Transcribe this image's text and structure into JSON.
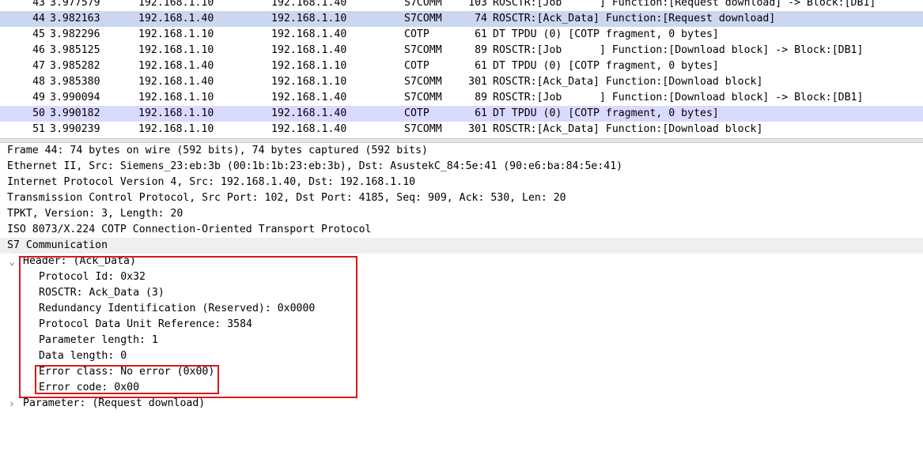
{
  "packet_list": {
    "rows": [
      {
        "no": "43",
        "time": "3.977579",
        "source": "192.168.1.10",
        "destination": "192.168.1.40",
        "protocol": "S7COMM",
        "length": "103",
        "info": "ROSCTR:[Job      ] Function:[Request download] -> Block:[DB1]",
        "style": "plain"
      },
      {
        "no": "44",
        "time": "3.982163",
        "source": "192.168.1.40",
        "destination": "192.168.1.10",
        "protocol": "S7COMM",
        "length": "74",
        "info": "ROSCTR:[Ack_Data] Function:[Request download]",
        "style": "selected"
      },
      {
        "no": "45",
        "time": "3.982296",
        "source": "192.168.1.10",
        "destination": "192.168.1.40",
        "protocol": "COTP",
        "length": "61",
        "info": "DT TPDU (0) [COTP fragment, 0 bytes]",
        "style": "plain"
      },
      {
        "no": "46",
        "time": "3.985125",
        "source": "192.168.1.10",
        "destination": "192.168.1.40",
        "protocol": "S7COMM",
        "length": "89",
        "info": "ROSCTR:[Job      ] Function:[Download block] -> Block:[DB1]",
        "style": "plain"
      },
      {
        "no": "47",
        "time": "3.985282",
        "source": "192.168.1.40",
        "destination": "192.168.1.10",
        "protocol": "COTP",
        "length": "61",
        "info": "DT TPDU (0) [COTP fragment, 0 bytes]",
        "style": "plain"
      },
      {
        "no": "48",
        "time": "3.985380",
        "source": "192.168.1.40",
        "destination": "192.168.1.10",
        "protocol": "S7COMM",
        "length": "301",
        "info": "ROSCTR:[Ack_Data] Function:[Download block]",
        "style": "plain"
      },
      {
        "no": "49",
        "time": "3.990094",
        "source": "192.168.1.10",
        "destination": "192.168.1.40",
        "protocol": "S7COMM",
        "length": "89",
        "info": "ROSCTR:[Job      ] Function:[Download block] -> Block:[DB1]",
        "style": "plain"
      },
      {
        "no": "50",
        "time": "3.990182",
        "source": "192.168.1.10",
        "destination": "192.168.1.40",
        "protocol": "COTP",
        "length": "61",
        "info": "DT TPDU (0) [COTP fragment, 0 bytes]",
        "style": "blue"
      },
      {
        "no": "51",
        "time": "3.990239",
        "source": "192.168.1.10",
        "destination": "192.168.1.40",
        "protocol": "S7COMM",
        "length": "301",
        "info": "ROSCTR:[Ack_Data] Function:[Download block]",
        "style": "plain"
      }
    ]
  },
  "details": {
    "frame": "Frame 44: 74 bytes on wire (592 bits), 74 bytes captured (592 bits)",
    "ethernet": "Ethernet II, Src: Siemens_23:eb:3b (00:1b:1b:23:eb:3b), Dst: AsustekC_84:5e:41 (90:e6:ba:84:5e:41)",
    "ip": "Internet Protocol Version 4, Src: 192.168.1.40, Dst: 192.168.1.10",
    "tcp": "Transmission Control Protocol, Src Port: 102, Dst Port: 4185, Seq: 909, Ack: 530, Len: 20",
    "tpkt": "TPKT, Version: 3, Length: 20",
    "cotp": "ISO 8073/X.224 COTP Connection-Oriented Transport Protocol",
    "s7": "S7 Communication",
    "header": {
      "label": "Header: (Ack_Data)",
      "expander": "⌄",
      "fields": {
        "protocol_id": "Protocol Id: 0x32",
        "rosctr": "ROSCTR: Ack_Data (3)",
        "redundancy": "Redundancy Identification (Reserved): 0x0000",
        "pdu_ref": "Protocol Data Unit Reference: 3584",
        "param_len": "Parameter length: 1",
        "data_len": "Data length: 0",
        "error_class": "Error class: No error (0x00)",
        "error_code": "Error code: 0x00"
      }
    },
    "parameter": {
      "label": "Parameter: (Request download)",
      "expander": "›"
    }
  },
  "colors": {
    "selected_row": "#cbd7f0",
    "blue_row": "#dadaff",
    "highlight_box": "#d8191c",
    "shaded_row": "#efefef"
  }
}
